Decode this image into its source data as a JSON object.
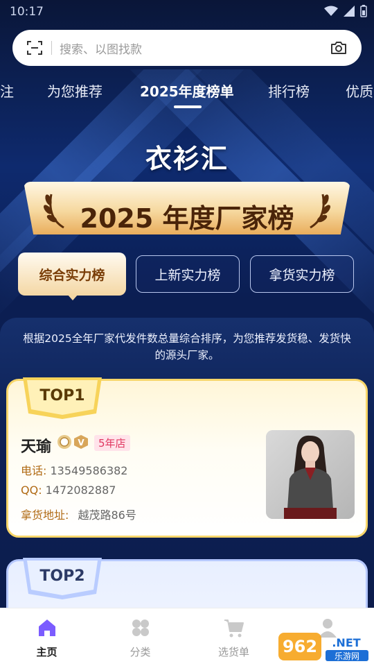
{
  "status_bar": {
    "time": "10:17"
  },
  "search": {
    "placeholder": "搜索、以图找款"
  },
  "tabs": [
    {
      "label": "注"
    },
    {
      "label": "为您推荐"
    },
    {
      "label": "2025年度榜单"
    },
    {
      "label": "排行榜"
    },
    {
      "label": "优质"
    }
  ],
  "active_tab": "2025年度榜单",
  "hero": {
    "brand": "衣衫汇",
    "title": "2025 年度厂家榜"
  },
  "ranking_tabs": [
    {
      "label": "综合实力榜",
      "active": true
    },
    {
      "label": "上新实力榜",
      "active": false
    },
    {
      "label": "拿货实力榜",
      "active": false
    }
  ],
  "description": "根据2025全年厂家代发件数总量综合排序，为您推荐发货稳、发货快的源头厂家。",
  "entries": [
    {
      "rank_label": "TOP1",
      "name": "天瑜",
      "years_badge": "5年店",
      "phone_label": "电话:",
      "phone": "13549586382",
      "qq_label": "QQ:",
      "qq": "1472082887",
      "address_label": "拿货地址:",
      "address": "越茂路86号"
    },
    {
      "rank_label": "TOP2"
    }
  ],
  "bottom_nav": [
    {
      "label": "主页",
      "icon": "home-icon",
      "active": true
    },
    {
      "label": "分类",
      "icon": "category-icon",
      "active": false
    },
    {
      "label": "选货单",
      "icon": "cart-icon",
      "active": false
    },
    {
      "label": "",
      "icon": "profile-icon",
      "active": false
    }
  ],
  "watermark": {
    "text": "962.NET",
    "subtext": "乐游网"
  },
  "colors": {
    "accent": "#7b5cff",
    "gold": "#f7d66a",
    "brand_text": "#4a2409",
    "badge_pink": "#e0355f"
  }
}
